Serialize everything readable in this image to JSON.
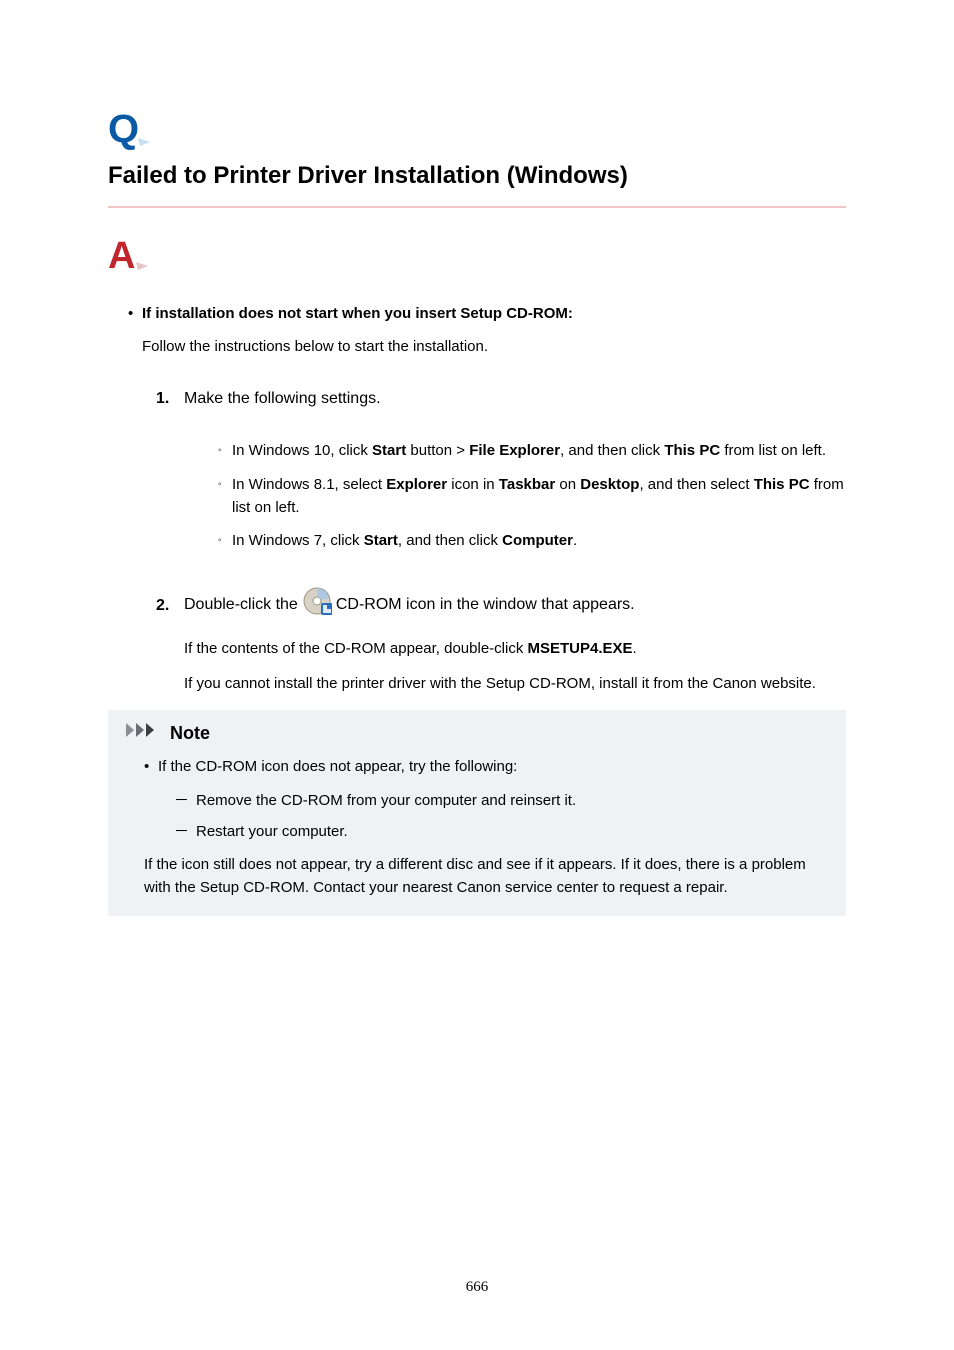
{
  "title": "Failed to Printer Driver Installation (Windows)",
  "section": {
    "heading": "If installation does not start when you insert Setup CD-ROM:",
    "follow": "Follow the instructions below to start the installation."
  },
  "step1": {
    "num": "1.",
    "text": "Make the following settings.",
    "sub": {
      "w10": {
        "pre": "In Windows 10, click ",
        "b1": "Start",
        "mid1": " button > ",
        "b2": "File Explorer",
        "mid2": ", and then click ",
        "b3": "This PC",
        "tail": " from list on left."
      },
      "w81": {
        "pre": "In Windows 8.1, select ",
        "b1": "Explorer",
        "mid1": " icon in ",
        "b2": "Taskbar",
        "mid2": " on ",
        "b3": "Desktop",
        "mid3": ", and then select ",
        "b4": "This PC",
        "tail": " from list on left."
      },
      "w7": {
        "pre": "In Windows 7, click ",
        "b1": "Start",
        "mid1": ", and then click ",
        "b2": "Computer",
        "tail": "."
      }
    }
  },
  "step2": {
    "num": "2.",
    "pre": "Double-click the",
    "post": "CD-ROM icon in the window that appears.",
    "line2a": "If the contents of the CD-ROM appear, double-click ",
    "line2b": "MSETUP4.EXE",
    "line2c": ".",
    "line3": "If you cannot install the printer driver with the Setup CD-ROM, install it from the Canon website."
  },
  "note": {
    "label": "Note",
    "b1": "If the CD-ROM icon does not appear, try the following:",
    "s1": "Remove the CD-ROM from your computer and reinsert it.",
    "s2": "Restart your computer.",
    "tail": "If the icon still does not appear, try a different disc and see if it appears. If it does, there is a problem with the Setup CD-ROM. Contact your nearest Canon service center to request a repair."
  },
  "pageNumber": "666"
}
